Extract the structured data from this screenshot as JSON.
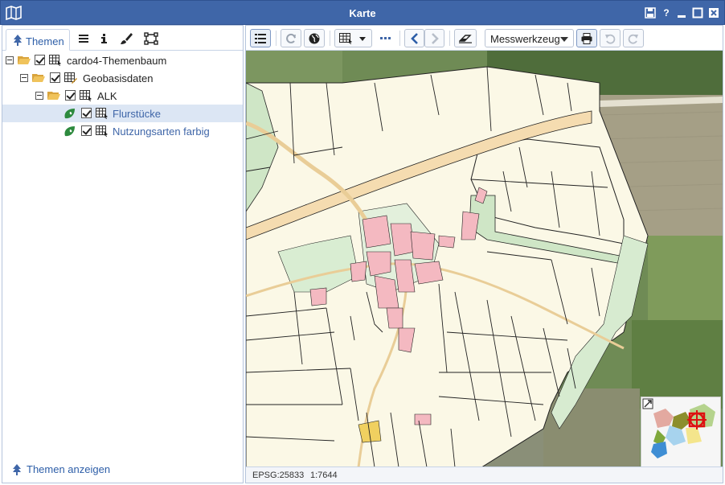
{
  "window": {
    "title": "Karte"
  },
  "left_panel": {
    "tabs": {
      "themen_label": "Themen"
    },
    "tree": [
      {
        "label": "cardo4-Themenbaum"
      },
      {
        "label": "Geobasisdaten"
      },
      {
        "label": "ALK"
      },
      {
        "label": "Flurstücke"
      },
      {
        "label": "Nutzungsarten farbig"
      }
    ],
    "footer": {
      "label": "Themen anzeigen"
    }
  },
  "map": {
    "toolbar": {
      "tool_select": "Messwerkzeug"
    },
    "status": {
      "epsg": "EPSG:25833",
      "scale": "1:7644"
    }
  },
  "colors": {
    "accent": "#3f66a8",
    "link": "#3f66a8",
    "parcel_fill": "#fbf8e6",
    "residential": "#f4b9c1",
    "green_area": "#cfe6c6",
    "road": "#f5dcb0"
  },
  "icons": [
    "map-icon",
    "save-icon",
    "help-icon",
    "minimize-icon",
    "maximize-icon",
    "close-icon",
    "tree-icon",
    "list-icon",
    "info-icon",
    "brush-icon",
    "topology-icon",
    "menu-icon",
    "refresh-icon",
    "globe-icon",
    "grid-select-icon",
    "chevron-down-icon",
    "more-icon",
    "back-icon",
    "forward-icon",
    "eraser-icon",
    "print-icon",
    "undo-icon",
    "redo-icon",
    "collapse-icon"
  ]
}
